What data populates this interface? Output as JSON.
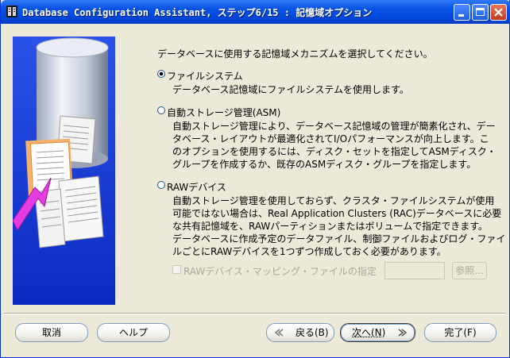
{
  "window": {
    "title": "Database Configuration Assistant, ステップ6/15 : 記憶域オプション"
  },
  "titlebar_icons": {
    "minimize": "minimize-icon",
    "maximize": "maximize-icon",
    "close": "close-icon"
  },
  "intro": "データベースに使用する記憶域メカニズムを選択してください。",
  "options": [
    {
      "label": "ファイルシステム",
      "selected": true,
      "desc": [
        "データベース記憶域にファイルシステムを使用します。"
      ]
    },
    {
      "label": "自動ストレージ管理(ASM)",
      "selected": false,
      "desc": [
        "自動ストレージ管理により、データベース記憶域の管理が簡素化され、デー",
        "タベース・レイアウトが最適化されてI/Oパフォーマンスが向上します。こ",
        "のオプションを使用するには、ディスク・セットを指定してASMディスク・",
        "グループを作成するか、既存のASMディスク・グループを指定します。"
      ]
    },
    {
      "label": "RAWデバイス",
      "selected": false,
      "desc": [
        "自動ストレージ管理を使用しておらず、クラスタ・ファイルシステムが使用",
        "可能ではない場合は、Real Application Clusters (RAC)データベースに必要",
        "な共有記憶域を、RAWパーティションまたはボリュームで指定できます。",
        "データベースに作成予定のデータファイル、制御ファイルおよびログ・ファイ",
        "ルごとにRAWデバイスを1つずつ作成しておく必要があります。"
      ]
    }
  ],
  "raw_mapping": {
    "label": "RAWデバイス・マッピング・ファイルの指定",
    "checked": false,
    "value": "",
    "browse": "参照..."
  },
  "buttons": {
    "cancel": "取消",
    "help": "ヘルプ",
    "back": "戻る(B)",
    "next": "次へ(N)",
    "finish": "完了(F)"
  },
  "colors": {
    "titlebar": "#0a54e3",
    "dialog_bg": "#ece9d8",
    "graphic_bg": "#1e3fd8",
    "accent_arrow": "#e63be0"
  }
}
